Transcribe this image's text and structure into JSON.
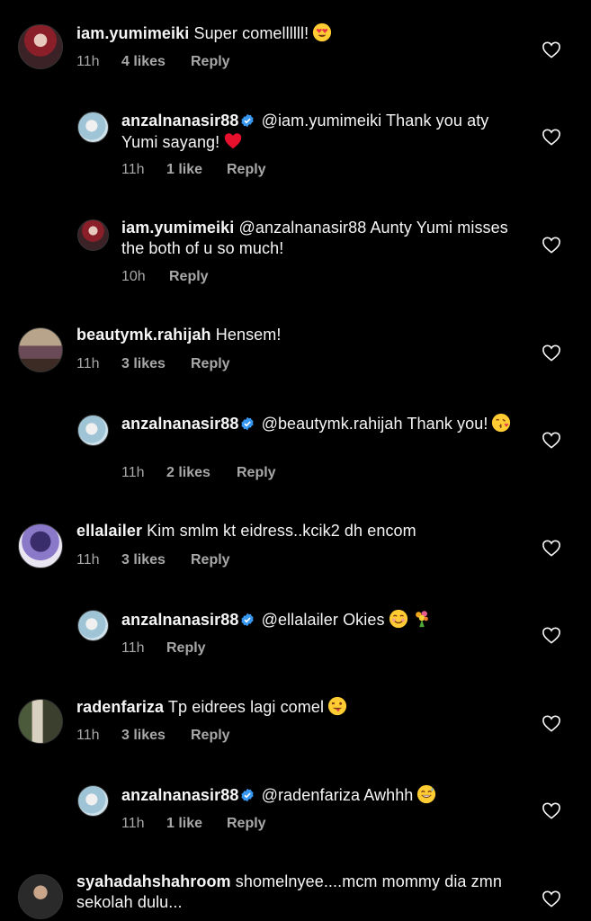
{
  "comments": [
    {
      "username": "iam.yumimeiki",
      "text": "Super comellllll!",
      "emoji": "heart-eyes",
      "time": "11h",
      "likes": "4 likes",
      "reply": "Reply"
    },
    {
      "username": "anzalnanasir88",
      "verified": true,
      "text": "@iam.yumimeiki Thank you aty Yumi sayang!",
      "emoji": "red-heart",
      "time": "11h",
      "likes": "1 like",
      "reply": "Reply"
    },
    {
      "username": "iam.yumimeiki",
      "text": "@anzalnanasir88 Aunty Yumi misses the both of u so much!",
      "time": "10h",
      "reply": "Reply"
    },
    {
      "username": "beautymk.rahijah",
      "text": "Hensem!",
      "time": "11h",
      "likes": "3 likes",
      "reply": "Reply"
    },
    {
      "username": "anzalnanasir88",
      "verified": true,
      "text": "@beautymk.rahijah Thank you!",
      "emoji": "kissing-face",
      "time": "11h",
      "likes": "2 likes",
      "reply": "Reply"
    },
    {
      "username": "ellalailer",
      "text": "Kim smlm kt eidress..kcik2 dh encom",
      "time": "11h",
      "likes": "3 likes",
      "reply": "Reply"
    },
    {
      "username": "anzalnanasir88",
      "verified": true,
      "text": "@ellalailer Okies",
      "emoji": "smiling-face-and-bouquet",
      "time": "11h",
      "reply": "Reply"
    },
    {
      "username": "radenfariza",
      "text": "Tp eidrees lagi comel",
      "emoji": "winking-tongue-face",
      "time": "11h",
      "likes": "3 likes",
      "reply": "Reply"
    },
    {
      "username": "anzalnanasir88",
      "verified": true,
      "text": "@radenfariza Awhhh",
      "emoji": "grinning-sweat-face",
      "time": "11h",
      "likes": "1 like",
      "reply": "Reply"
    },
    {
      "username": "syahadahshahroom",
      "text": "shomelnyee....mcm mommy dia zmn sekolah dulu..."
    }
  ],
  "colors": {
    "background": "#000000",
    "text": "#f5f5f5",
    "meta": "#a8a8a8",
    "verified": "#3897f0"
  }
}
